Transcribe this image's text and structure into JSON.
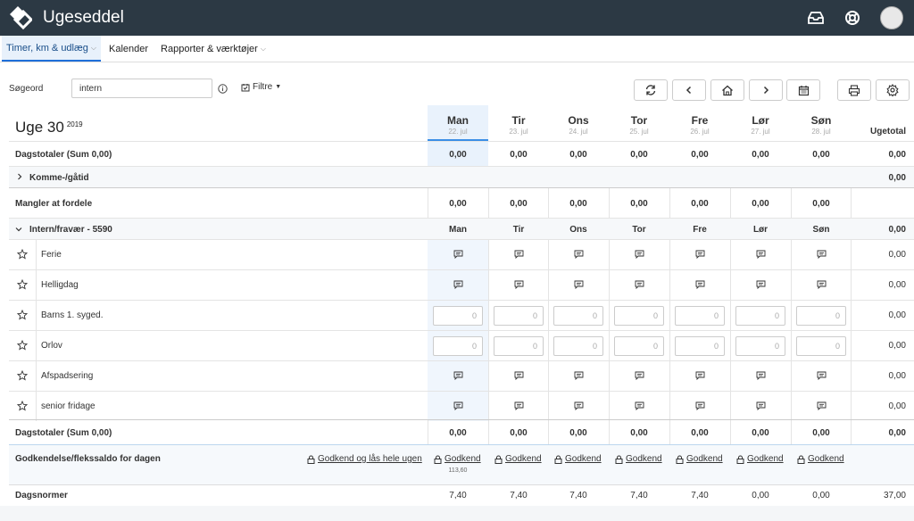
{
  "app": {
    "title": "Ugeseddel"
  },
  "nav": {
    "items": [
      {
        "label": "Timer, km & udlæg",
        "has_caret": true,
        "active": true
      },
      {
        "label": "Kalender",
        "has_caret": false,
        "active": false
      },
      {
        "label": "Rapporter & værktøjer",
        "has_caret": true,
        "active": false
      }
    ]
  },
  "search": {
    "label": "Søgeord",
    "value": "intern",
    "filter_label": "Filtre"
  },
  "week": {
    "title": "Uge 30",
    "year": "2019"
  },
  "days": [
    {
      "name": "Man",
      "date": "22. jul"
    },
    {
      "name": "Tir",
      "date": "23. jul"
    },
    {
      "name": "Ons",
      "date": "24. jul"
    },
    {
      "name": "Tor",
      "date": "25. jul"
    },
    {
      "name": "Fre",
      "date": "26. jul"
    },
    {
      "name": "Lør",
      "date": "27. jul"
    },
    {
      "name": "Søn",
      "date": "28. jul"
    }
  ],
  "ugetotal_label": "Ugetotal",
  "dagstotaler": {
    "label": "Dagstotaler (Sum 0,00)",
    "values": [
      "0,00",
      "0,00",
      "0,00",
      "0,00",
      "0,00",
      "0,00",
      "0,00"
    ],
    "total": "0,00"
  },
  "komme": {
    "label": "Komme-/gåtid",
    "total": "0,00"
  },
  "mangler": {
    "label": "Mangler at fordele",
    "values": [
      "0,00",
      "0,00",
      "0,00",
      "0,00",
      "0,00",
      "0,00",
      "0,00"
    ]
  },
  "intern": {
    "label": "Intern/fravær - 5590",
    "days": [
      "Man",
      "Tir",
      "Ons",
      "Tor",
      "Fre",
      "Lør",
      "Søn"
    ],
    "total": "0,00"
  },
  "activities": [
    {
      "label": "Ferie",
      "type": "comment",
      "total": "0,00"
    },
    {
      "label": "Helligdag",
      "type": "comment",
      "total": "0,00"
    },
    {
      "label": "Barns 1. syged.",
      "type": "input",
      "value": "0",
      "total": "0,00"
    },
    {
      "label": "Orlov",
      "type": "input",
      "value": "0",
      "total": "0,00"
    },
    {
      "label": "Afspadsering",
      "type": "comment",
      "total": "0,00"
    },
    {
      "label": "senior fridage",
      "type": "comment",
      "total": "0,00"
    }
  ],
  "dagstotaler_bottom": {
    "label": "Dagstotaler (Sum 0,00)",
    "values": [
      "0,00",
      "0,00",
      "0,00",
      "0,00",
      "0,00",
      "0,00",
      "0,00"
    ],
    "total": "0,00"
  },
  "godkendelse": {
    "label": "Godkendelse/flekssaldo for dagen",
    "approve_all": "Godkend og lås hele ugen",
    "approve_day": "Godkend",
    "flex_monday": "113,60"
  },
  "dagsnormer": {
    "label": "Dagsnormer",
    "values": [
      "7,40",
      "7,40",
      "7,40",
      "7,40",
      "7,40",
      "0,00",
      "0,00"
    ],
    "total": "37,00"
  }
}
